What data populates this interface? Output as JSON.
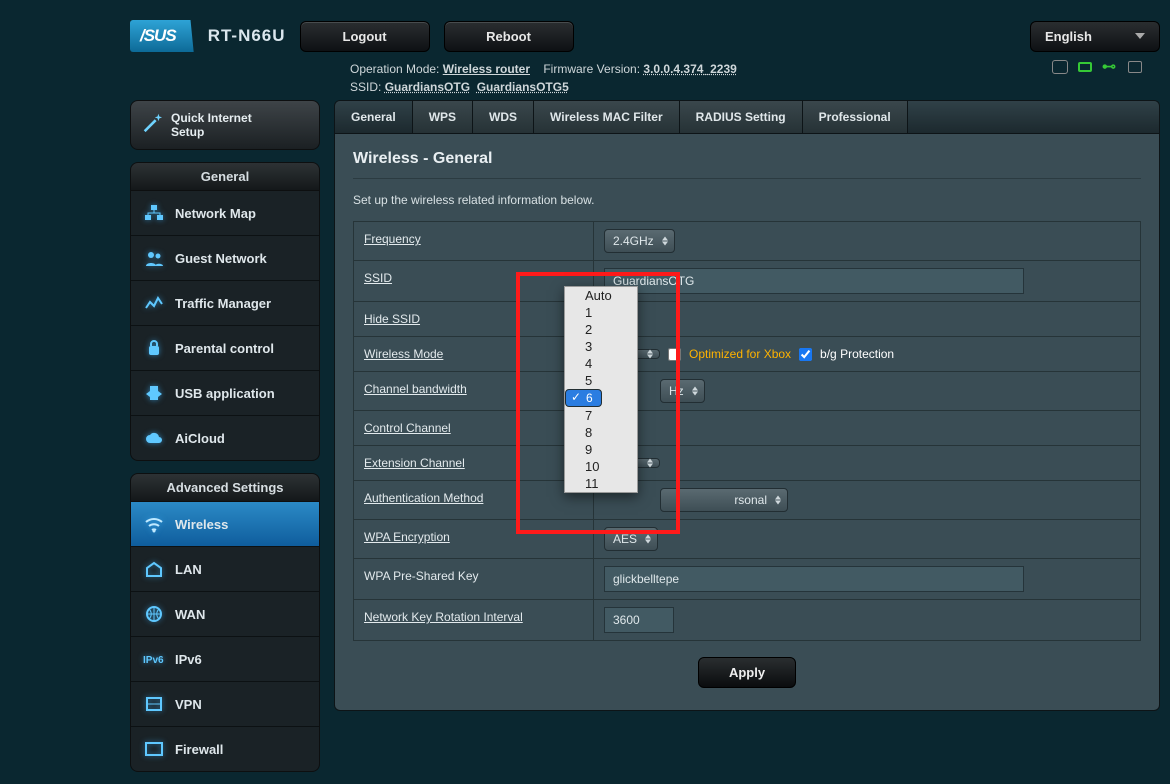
{
  "brand": "/SUS",
  "model": "RT-N66U",
  "buttons": {
    "logout": "Logout",
    "reboot": "Reboot",
    "apply": "Apply"
  },
  "language": "English",
  "opmode_label": "Operation Mode:",
  "opmode": "Wireless router",
  "fw_label": "Firmware Version:",
  "fw": "3.0.0.4.374_2239",
  "ssid_label": "SSID:",
  "ssid1": "GuardiansOTG",
  "ssid2": "GuardiansOTG5",
  "qis": {
    "l1": "Quick Internet",
    "l2": "Setup"
  },
  "section_general": "General",
  "section_adv": "Advanced Settings",
  "nav_general": [
    "Network Map",
    "Guest Network",
    "Traffic Manager",
    "Parental control",
    "USB application",
    "AiCloud"
  ],
  "nav_adv": [
    "Wireless",
    "LAN",
    "WAN",
    "IPv6",
    "VPN",
    "Firewall"
  ],
  "tabs": [
    "General",
    "WPS",
    "WDS",
    "Wireless MAC Filter",
    "RADIUS Setting",
    "Professional"
  ],
  "page_title": "Wireless - General",
  "page_desc": "Set up the wireless related information below.",
  "rows": {
    "freq": {
      "label": "Frequency",
      "value": "2.4GHz"
    },
    "ssid": {
      "label": "SSID",
      "value": "GuardiansOTG"
    },
    "hide": {
      "label": "Hide SSID"
    },
    "mode": {
      "label": "Wireless Mode",
      "xbox": "Optimized for Xbox",
      "bg": "b/g Protection"
    },
    "bw": {
      "label": "Channel bandwidth",
      "value": "Hz"
    },
    "chan": {
      "label": "Control Channel"
    },
    "ext": {
      "label": "Extension Channel"
    },
    "auth": {
      "label": "Authentication Method",
      "value": "rsonal"
    },
    "enc": {
      "label": "WPA Encryption",
      "value": "AES"
    },
    "psk": {
      "label": "WPA Pre-Shared Key",
      "value": "glickbelltepe"
    },
    "rot": {
      "label": "Network Key Rotation Interval",
      "value": "3600"
    }
  },
  "dropdown": {
    "options": [
      "Auto",
      "1",
      "2",
      "3",
      "4",
      "5",
      "6",
      "7",
      "8",
      "9",
      "10",
      "11"
    ],
    "selected": "6"
  }
}
